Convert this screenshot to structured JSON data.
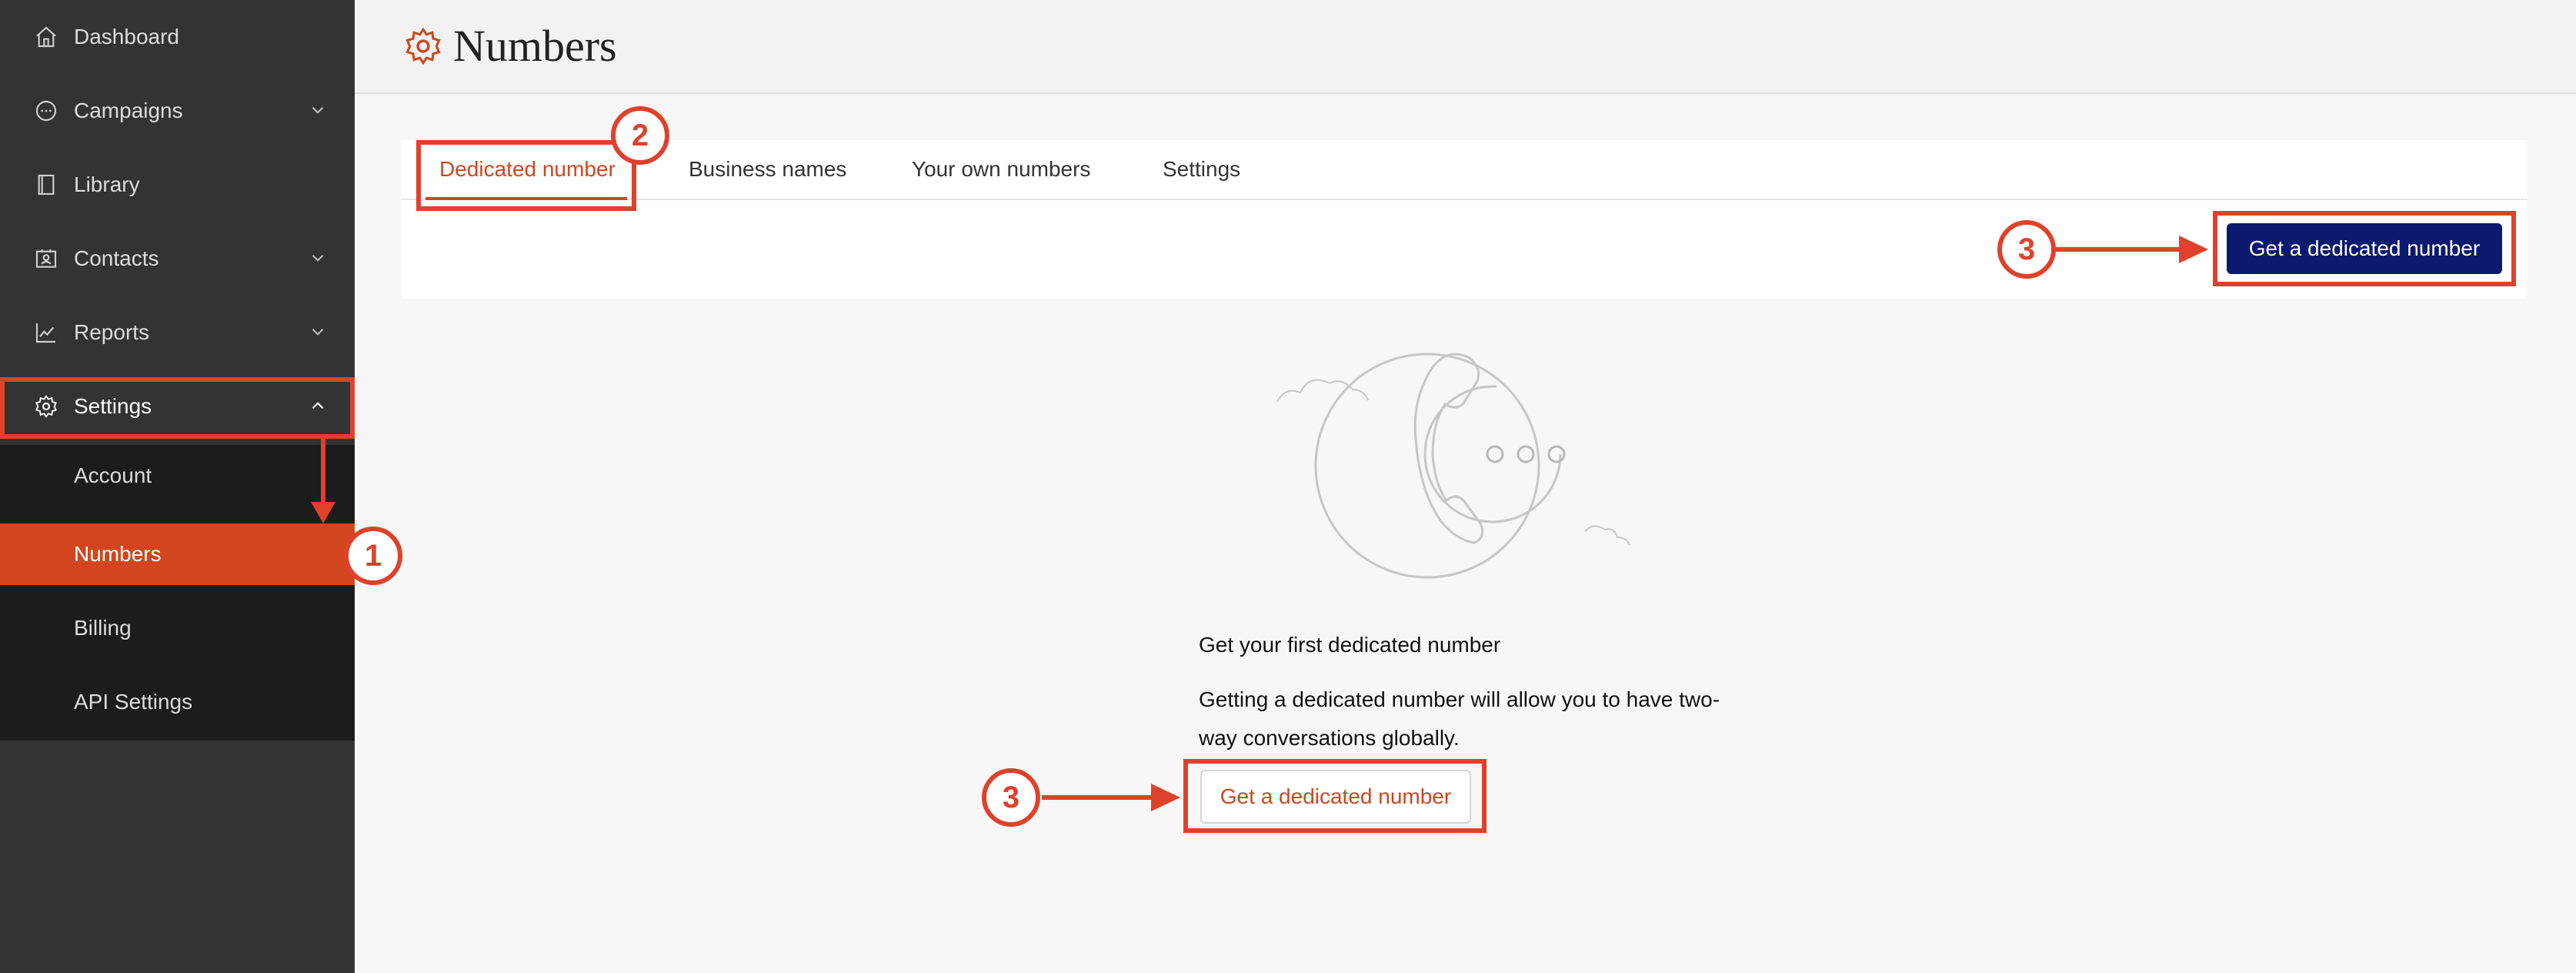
{
  "sidebar": {
    "items": [
      {
        "label": "Dashboard",
        "icon": "home-icon"
      },
      {
        "label": "Campaigns",
        "icon": "chat-bubble-icon"
      },
      {
        "label": "Library",
        "icon": "book-icon"
      },
      {
        "label": "Contacts",
        "icon": "contact-card-icon"
      },
      {
        "label": "Reports",
        "icon": "line-chart-icon"
      },
      {
        "label": "Settings",
        "icon": "gear-icon"
      }
    ],
    "submenu": [
      {
        "label": "Account"
      },
      {
        "label": "Numbers"
      },
      {
        "label": "Billing"
      },
      {
        "label": "API Settings"
      }
    ]
  },
  "header": {
    "title": "Numbers"
  },
  "tabs": [
    {
      "label": "Dedicated number"
    },
    {
      "label": "Business names"
    },
    {
      "label": "Your own numbers"
    },
    {
      "label": "Settings"
    }
  ],
  "toolbar": {
    "primary_button": "Get a dedicated number"
  },
  "empty_state": {
    "heading": "Get your first dedicated number",
    "description": "Getting a dedicated number will allow you to have two-way conversations globally.",
    "button": "Get a dedicated number"
  },
  "annotations": {
    "step1": "1",
    "step2": "2",
    "step3": "3"
  },
  "colors": {
    "accent": "#d2451e",
    "primary": "#0b1a6e",
    "sidebar": "#333333",
    "annotation": "#e0412a"
  }
}
